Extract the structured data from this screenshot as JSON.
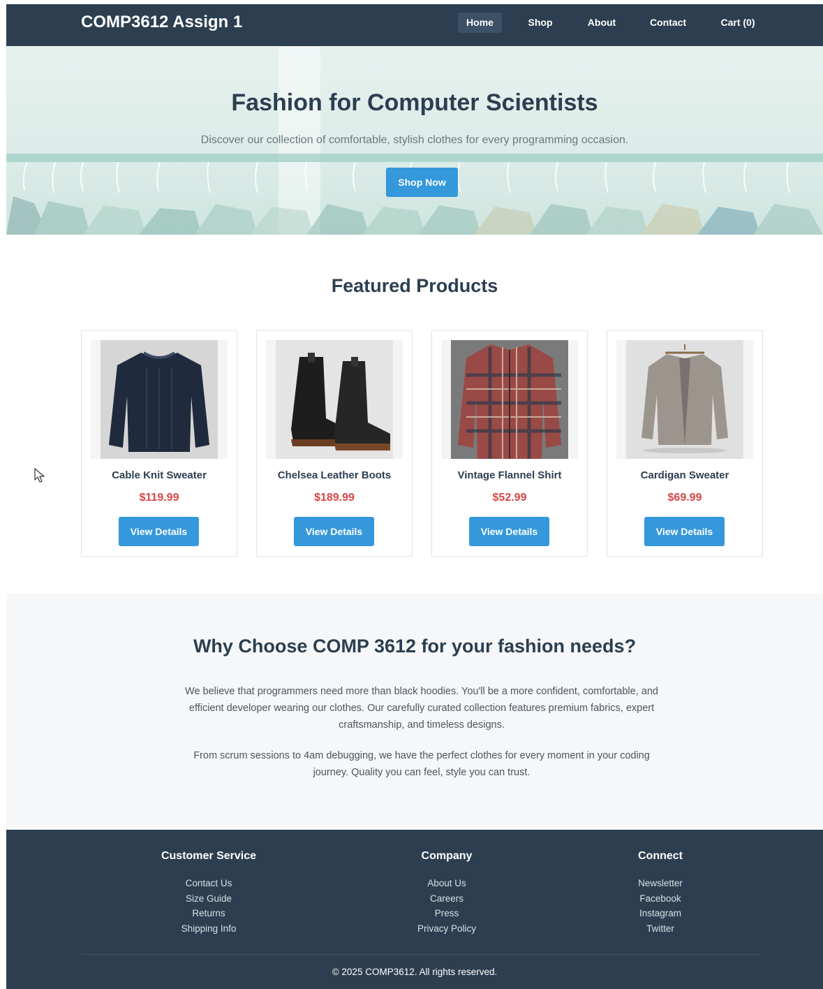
{
  "header": {
    "brand": "COMP3612 Assign 1",
    "nav": [
      "Home",
      "Shop",
      "About",
      "Contact",
      "Cart (0)"
    ],
    "active": "Home"
  },
  "hero": {
    "title": "Fashion for Computer Scientists",
    "subtitle": "Discover our collection of comfortable, stylish clothes for every programming occasion.",
    "cta": "Shop Now"
  },
  "featured": {
    "title": "Featured Products",
    "products": [
      {
        "name": "Cable Knit Sweater",
        "price": "$119.99",
        "button": "View Details",
        "image": "sweater-image"
      },
      {
        "name": "Chelsea Leather Boots",
        "price": "$189.99",
        "button": "View Details",
        "image": "boots-image"
      },
      {
        "name": "Vintage Flannel Shirt",
        "price": "$52.99",
        "button": "View Details",
        "image": "flannel-image"
      },
      {
        "name": "Cardigan Sweater",
        "price": "$69.99",
        "button": "View Details",
        "image": "cardigan-image"
      }
    ]
  },
  "why": {
    "title": "Why Choose COMP 3612 for your fashion needs?",
    "p1": "We believe that programmers need more than black hoodies. You'll be a more confident, comfortable, and efficient developer wearing our clothes. Our carefully curated collection features premium fabrics, expert craftsmanship, and timeless designs.",
    "p2": "From scrum sessions to 4am debugging, we have the perfect clothes for every moment in your coding journey. Quality you can feel, style you can trust."
  },
  "footer": {
    "columns": [
      {
        "heading": "Customer Service",
        "links": [
          "Contact Us",
          "Size Guide",
          "Returns",
          "Shipping Info"
        ]
      },
      {
        "heading": "Company",
        "links": [
          "About Us",
          "Careers",
          "Press",
          "Privacy Policy"
        ]
      },
      {
        "heading": "Connect",
        "links": [
          "Newsletter",
          "Facebook",
          "Instagram",
          "Twitter"
        ]
      }
    ],
    "copyright": "© 2025 COMP3612. All rights reserved."
  },
  "colors": {
    "navy": "#2c3e50",
    "accent": "#3498db",
    "price": "#d64545"
  }
}
